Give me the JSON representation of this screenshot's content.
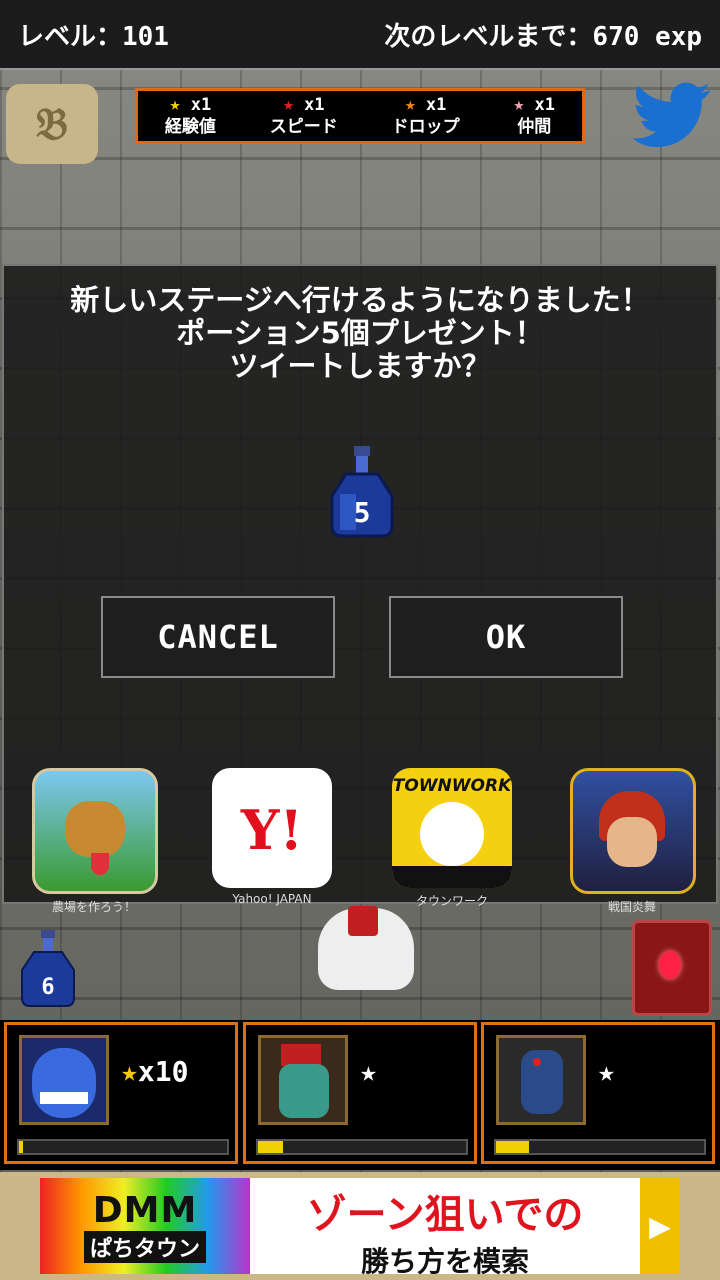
{
  "status": {
    "level_label": "レベル：101",
    "next_label": "次のレベルまで：670 exp"
  },
  "bonuses": [
    {
      "mult": "x1",
      "name": "経験値",
      "star_color": "#f5d000"
    },
    {
      "mult": "x1",
      "name": "スピード",
      "star_color": "#e82020"
    },
    {
      "mult": "x1",
      "name": "ドロップ",
      "star_color": "#f08020"
    },
    {
      "mult": "x1",
      "name": "仲間",
      "star_color": "#f0a0b0"
    }
  ],
  "dialog": {
    "message": "新しいステージへ行けるようになりました！\nポーション5個プレゼント！\nツイートしますか？",
    "potion_count": "5",
    "cancel_label": "CANCEL",
    "ok_label": "OK"
  },
  "apps": [
    {
      "label": "農場を作ろう！"
    },
    {
      "label": "Yahoo! JAPAN",
      "logo_text": "Y!"
    },
    {
      "label": "タウンワーク",
      "logo_text": "TOWNWORK"
    },
    {
      "label": "戦国炎舞"
    }
  ],
  "inventory": {
    "potion_count": "6"
  },
  "party": [
    {
      "stars": "★",
      "mult": "x10",
      "gold": true,
      "progress": 0.02
    },
    {
      "stars": "★",
      "mult": "",
      "gold": false,
      "progress": 0.12
    },
    {
      "stars": "★",
      "mult": "",
      "gold": false,
      "progress": 0.16
    }
  ],
  "ad": {
    "logo_line1": "DMM",
    "logo_line2": "ぱちタウン",
    "headline": "ゾーン狙いでの",
    "subline": "勝ち方を模索",
    "arrow": "▶"
  }
}
